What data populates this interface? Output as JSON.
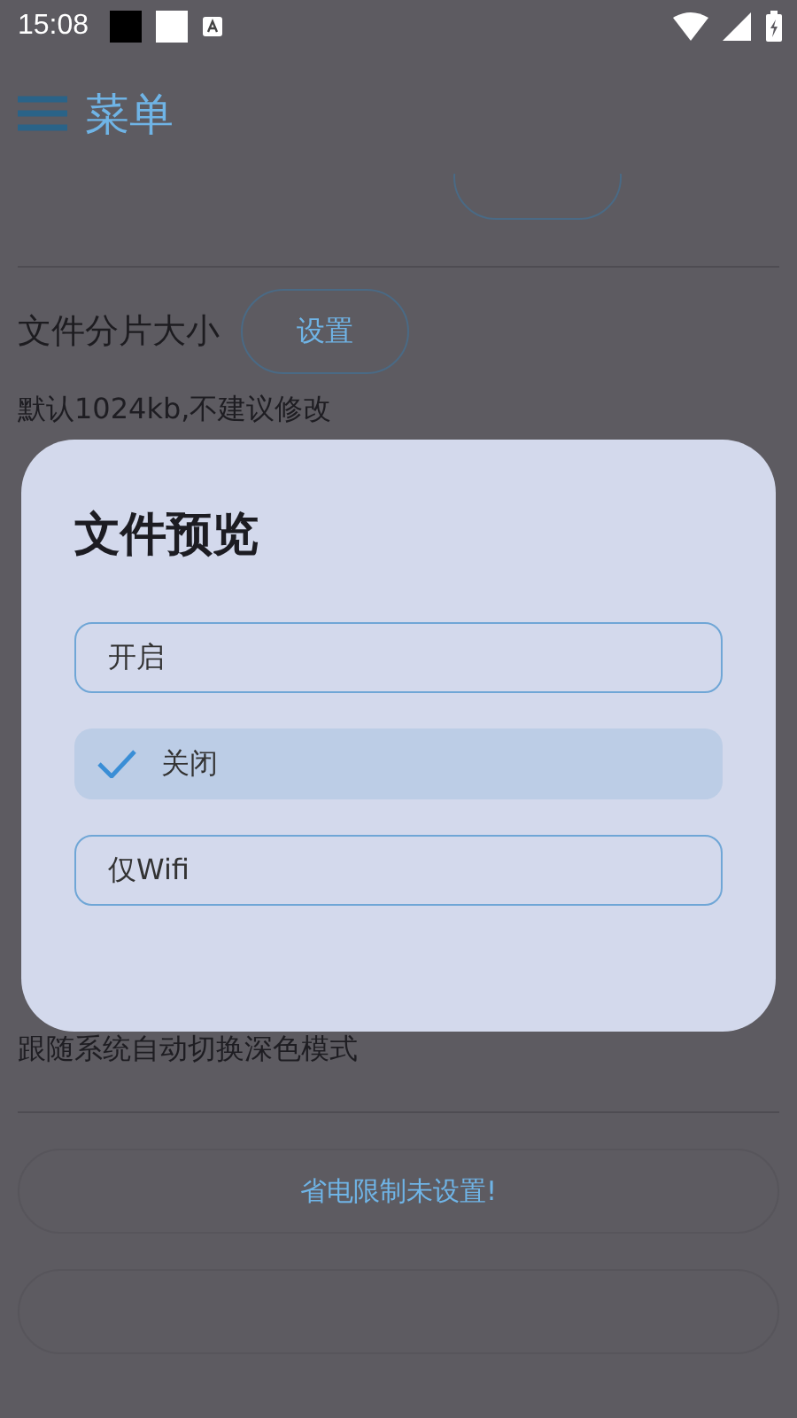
{
  "status_bar": {
    "time": "15:08"
  },
  "app_bar": {
    "title": "菜单"
  },
  "settings": [
    {
      "kind": "cut-button"
    },
    {
      "kind": "row",
      "label": "文件分片大小",
      "button": "设置",
      "hint": "默认1024kb,不建议修改"
    },
    {
      "kind": "hint",
      "hint": "跟随系统自动切换深色模式"
    },
    {
      "kind": "wide-button",
      "button": "省电限制未设置!"
    },
    {
      "kind": "wide-button"
    }
  ],
  "dialog": {
    "title": "文件预览",
    "options": [
      {
        "label": "开启",
        "selected": false
      },
      {
        "label": "关闭",
        "selected": true
      },
      {
        "label": "仅Wifi",
        "selected": false
      }
    ]
  }
}
